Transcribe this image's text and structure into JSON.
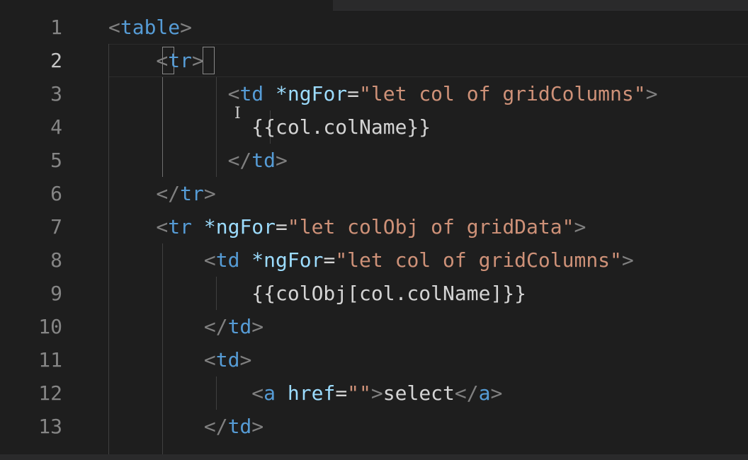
{
  "editor": {
    "active_line": 2,
    "line_numbers": [
      "1",
      "2",
      "3",
      "4",
      "5",
      "6",
      "7",
      "8",
      "9",
      "10",
      "11",
      "12",
      "13"
    ],
    "lines": [
      [
        [
          "punct",
          "<"
        ],
        [
          "tag",
          "table"
        ],
        [
          "punct",
          ">"
        ]
      ],
      [
        [
          "punct",
          "    <"
        ],
        [
          "tag",
          "tr"
        ],
        [
          "punct",
          ">"
        ]
      ],
      [
        [
          "txt",
          "          "
        ],
        [
          "punct",
          "<"
        ],
        [
          "tag",
          "td"
        ],
        [
          "txt",
          " "
        ],
        [
          "attr",
          "*ngFor"
        ],
        [
          "txt",
          "="
        ],
        [
          "str",
          "\"let col of gridColumns\""
        ],
        [
          "punct",
          ">"
        ]
      ],
      [
        [
          "txt",
          "            {{col.colName}}"
        ]
      ],
      [
        [
          "txt",
          "          "
        ],
        [
          "punct",
          "</"
        ],
        [
          "tag",
          "td"
        ],
        [
          "punct",
          ">"
        ]
      ],
      [
        [
          "punct",
          "    </"
        ],
        [
          "tag",
          "tr"
        ],
        [
          "punct",
          ">"
        ]
      ],
      [
        [
          "punct",
          "    <"
        ],
        [
          "tag",
          "tr"
        ],
        [
          "txt",
          " "
        ],
        [
          "attr",
          "*ngFor"
        ],
        [
          "txt",
          "="
        ],
        [
          "str",
          "\"let colObj of gridData\""
        ],
        [
          "punct",
          ">"
        ]
      ],
      [
        [
          "txt",
          "        "
        ],
        [
          "punct",
          "<"
        ],
        [
          "tag",
          "td"
        ],
        [
          "txt",
          " "
        ],
        [
          "attr",
          "*ngFor"
        ],
        [
          "txt",
          "="
        ],
        [
          "str",
          "\"let col of gridColumns\""
        ],
        [
          "punct",
          ">"
        ]
      ],
      [
        [
          "txt",
          "            {{colObj[col.colName]}}"
        ]
      ],
      [
        [
          "txt",
          "        "
        ],
        [
          "punct",
          "</"
        ],
        [
          "tag",
          "td"
        ],
        [
          "punct",
          ">"
        ]
      ],
      [
        [
          "txt",
          "        "
        ],
        [
          "punct",
          "<"
        ],
        [
          "tag",
          "td"
        ],
        [
          "punct",
          ">"
        ]
      ],
      [
        [
          "txt",
          "            "
        ],
        [
          "punct",
          "<"
        ],
        [
          "tag",
          "a"
        ],
        [
          "txt",
          " "
        ],
        [
          "attr",
          "href"
        ],
        [
          "txt",
          "="
        ],
        [
          "str",
          "\"\""
        ],
        [
          "punct",
          ">"
        ],
        [
          "txt",
          "select"
        ],
        [
          "punct",
          "</"
        ],
        [
          "tag",
          "a"
        ],
        [
          "punct",
          ">"
        ]
      ],
      [
        [
          "txt",
          "        "
        ],
        [
          "punct",
          "</"
        ],
        [
          "tag",
          "td"
        ],
        [
          "punct",
          ">"
        ]
      ]
    ]
  },
  "colors": {
    "background": "#1e1e1e",
    "tag": "#569cd6",
    "attribute": "#9cdcfe",
    "string": "#ce9178",
    "punctuation": "#808080",
    "text": "#d4d4d4"
  }
}
